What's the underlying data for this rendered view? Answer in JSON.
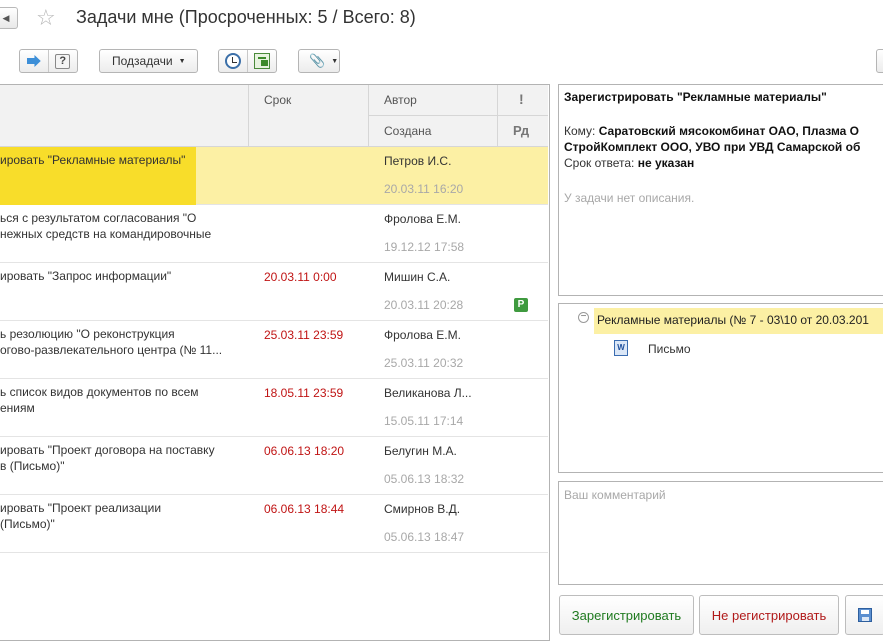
{
  "header": {
    "title": "Задачи мне (Просроченных: 5 / Всего: 8)"
  },
  "toolbar": {
    "subtasks_label": "Подзадачи"
  },
  "icons": {
    "back": "chevron-left-icon",
    "star": "star-icon",
    "next": "arrow-right-icon",
    "help": "question-icon",
    "clock": "clock-icon",
    "tree": "subtask-tree-icon",
    "attach": "paperclip-icon",
    "word": "word-document-icon",
    "save": "floppy-icon"
  },
  "grid": {
    "columns": {
      "due": "Срок",
      "author": "Автор",
      "importance": "!",
      "created": "Создана",
      "review": "Рд"
    },
    "rows": [
      {
        "subject": [
          "ировать \"Рекламные материалы\"",
          ""
        ],
        "due": "",
        "author": "Петров И.С.",
        "created": "20.03.11 16:20",
        "flag": ""
      },
      {
        "subject": [
          "ься с результатом согласования \"О",
          "нежных средств на командировочные"
        ],
        "due": "",
        "author": "Фролова Е.М.",
        "created": "19.12.12 17:58",
        "flag": ""
      },
      {
        "subject": [
          "ировать \"Запрос информации\"",
          ""
        ],
        "due": "20.03.11 0:00",
        "author": "Мишин С.А.",
        "created": "20.03.11 20:28",
        "flag": "Р"
      },
      {
        "subject": [
          "ь резолюцию \"О реконструкция",
          "оговo-развлекательного центра (№ 11..."
        ],
        "due": "25.03.11 23:59",
        "author": "Фролова Е.М.",
        "created": "25.03.11 20:32",
        "flag": ""
      },
      {
        "subject": [
          "ь список видов документов по всем",
          "ениям"
        ],
        "due": "18.05.11 23:59",
        "author": "Великанова Л...",
        "created": "15.05.11 17:14",
        "flag": ""
      },
      {
        "subject": [
          "ировать \"Проект договора на поставку",
          "в (Письмо)\""
        ],
        "due": "06.06.13 18:20",
        "author": "Белугин М.А.",
        "created": "05.06.13 18:32",
        "flag": ""
      },
      {
        "subject": [
          "ировать \"Проект реализации",
          " (Письмо)\""
        ],
        "due": "06.06.13 18:44",
        "author": "Смирнов В.Д.",
        "created": "05.06.13 18:47",
        "flag": ""
      }
    ]
  },
  "details": {
    "title": "Зарегистрировать \"Рекламные материалы\"",
    "to_label": "Кому:",
    "to_value_1": "Саратовский мясокомбинат ОАО, Плазма О",
    "to_value_2": "СтройКомплект ООО, УВО при УВД Самарской об",
    "deadline_label": "Срок ответа:",
    "deadline_value": "не указан",
    "no_description": "У задачи нет описания."
  },
  "attachments": {
    "group": "Рекламные материалы (№ 7 - 03\\10 от 20.03.201",
    "item": "Письмо"
  },
  "comment": {
    "placeholder": "Ваш комментарий"
  },
  "actions": {
    "register": "Зарегистрировать",
    "not_register": "Не регистрировать"
  },
  "colors": {
    "selected_row": "#fcf0a4",
    "selected_highlight": "#f8dd2a",
    "overdue": "#c01414",
    "accept_text": "#1f7a1f",
    "reject_text": "#b11a1a"
  }
}
